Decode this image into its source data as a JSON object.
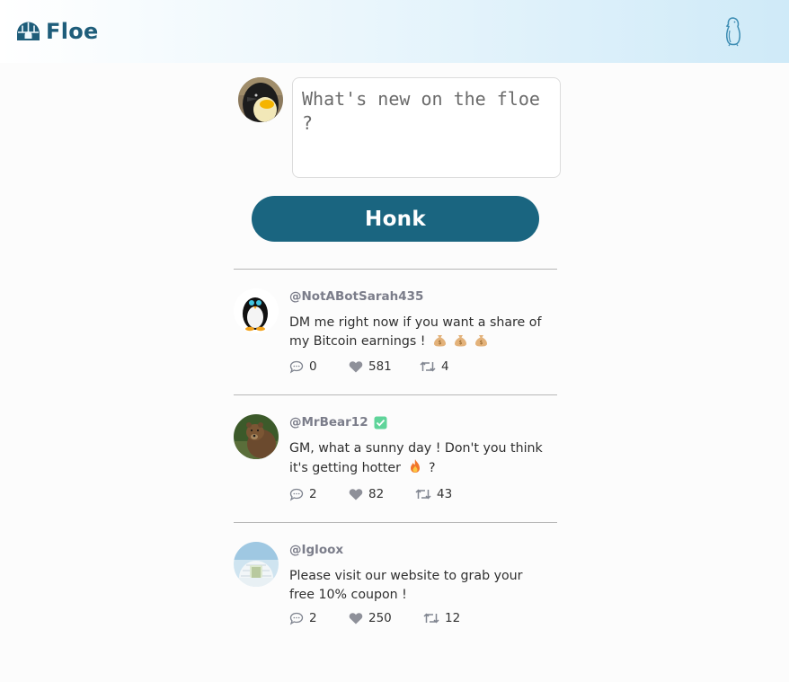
{
  "app": {
    "name": "Floe",
    "logo_icon": "igloo-icon",
    "nav_icon": "penguin-icon"
  },
  "composer": {
    "placeholder": "What's new on the floe ?",
    "value": "",
    "submit_label": "Honk"
  },
  "colors": {
    "brand": "#1e5d7a",
    "button": "#1a6580",
    "verified": "#5fd49a",
    "header_gradient_end": "#cfeaf8"
  },
  "posts": [
    {
      "handle": "@NotABotSarah435",
      "verified": false,
      "text": "DM me right now if you want a share of my Bitcoin earnings !",
      "text_emoji": "money-bag x3",
      "comments": "0",
      "likes": "581",
      "reposts": "4"
    },
    {
      "handle": "@MrBear12",
      "verified": true,
      "text_before": "GM, what a sunny day ! Don't you think it's getting hotter",
      "text_emoji": "fire",
      "text_after": "?",
      "comments": "2",
      "likes": "82",
      "reposts": "43"
    },
    {
      "handle": "@Igloox",
      "verified": false,
      "text": "Please visit our website to grab your free 10% coupon !",
      "comments": "2",
      "likes": "250",
      "reposts": "12"
    }
  ]
}
